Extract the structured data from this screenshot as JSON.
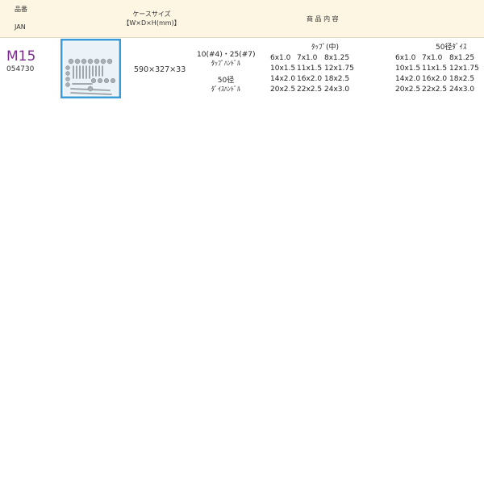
{
  "header": {
    "hinban": "品番",
    "jan": "JAN",
    "case_size_line1": "ケースサイズ",
    "case_size_line2": "【W×D×H(mm)】",
    "contents": "商 品 内 容"
  },
  "product": {
    "code": "M15",
    "jan": "054730",
    "dimensions": "590×327×33",
    "handles": {
      "tap_size": "10(#4)・25(#7)",
      "tap_label": "ﾀｯﾌﾟﾊﾝﾄﾞﾙ",
      "die_size": "50径",
      "die_label": "ﾀﾞｲｽﾊﾝﾄﾞﾙ"
    },
    "taps": {
      "heading": "ﾀｯﾌﾟ(中)",
      "rows": [
        [
          "6x1.0",
          "7x1.0",
          "8x1.25"
        ],
        [
          "10x1.5",
          "11x1.5",
          "12x1.75"
        ],
        [
          "14x2.0",
          "16x2.0",
          "18x2.5"
        ],
        [
          "20x2.5",
          "22x2.5",
          "24x3.0"
        ]
      ]
    },
    "dies": {
      "heading": "50径ﾀﾞｲｽ",
      "rows": [
        [
          "6x1.0",
          "7x1.0",
          "8x1.25"
        ],
        [
          "10x1.5",
          "11x1.5",
          "12x1.75"
        ],
        [
          "14x2.0",
          "16x2.0",
          "18x2.5"
        ],
        [
          "20x2.5",
          "22x2.5",
          "24x3.0"
        ]
      ]
    }
  },
  "colors": {
    "header_bg": "#fdf6e3",
    "code": "#7b2a8e",
    "case_blue": "#3a9bd9"
  }
}
